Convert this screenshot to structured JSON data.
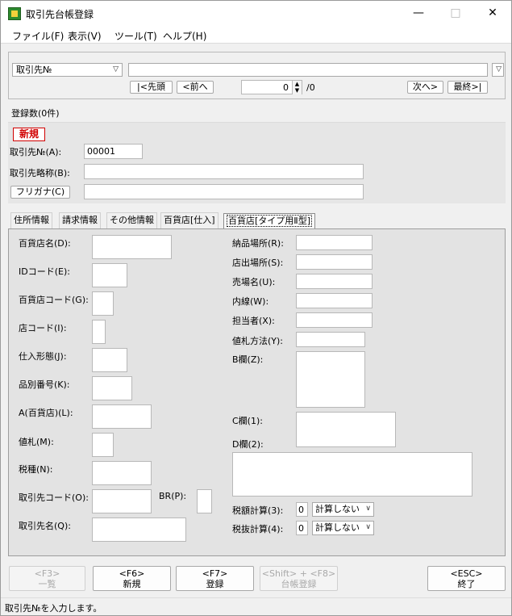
{
  "window": {
    "title": "取引先台帳登録",
    "minimize": "—",
    "maximize": "□",
    "close": "✕"
  },
  "menu": {
    "items": [
      "ファイル(F)",
      "表示(V)",
      "ツール(T)",
      "ヘルプ(H)"
    ]
  },
  "nav": {
    "key_select": "取引先№",
    "key_value": "",
    "first": "|<先頭",
    "prev": "<前へ",
    "position": "0",
    "total": "/0",
    "next": "次へ>",
    "last": "最終>|"
  },
  "count_label": "登録数(0件)",
  "new_badge": "新規",
  "header_fields": {
    "no_label": "取引先№(A):",
    "no_value": "00001",
    "short_name_label": "取引先略称(B):",
    "short_name_value": "",
    "furigana_button": "フリガナ(C)",
    "furigana_value": ""
  },
  "tabs": [
    "住所情報",
    "請求情報",
    "その他情報",
    "百貨店[仕入]",
    "百貨店[タイプ用Ⅱ型]"
  ],
  "left_fields": [
    {
      "label": "百貨店名(D):",
      "value": ""
    },
    {
      "label": "IDコード(E):",
      "value": ""
    },
    {
      "label": "百貨店コード(G):",
      "value": ""
    },
    {
      "label": "店コード(I):",
      "value": ""
    },
    {
      "label": "仕入形態(J):",
      "value": ""
    },
    {
      "label": "品別番号(K):",
      "value": ""
    },
    {
      "label": "A(百貨店)(L):",
      "value": ""
    },
    {
      "label": "値札(M):",
      "value": ""
    },
    {
      "label": "税種(N):",
      "value": ""
    },
    {
      "label": "取引先コード(O):",
      "value": ""
    },
    {
      "label": "取引先名(Q):",
      "value": ""
    }
  ],
  "br_label": "BR(P):",
  "right_fields": [
    {
      "label": "納品場所(R):",
      "value": ""
    },
    {
      "label": "店出場所(S):",
      "value": ""
    },
    {
      "label": "売場名(U):",
      "value": ""
    },
    {
      "label": "内線(W):",
      "value": ""
    },
    {
      "label": "担当者(X):",
      "value": ""
    },
    {
      "label": "値札方法(Y):",
      "value": ""
    },
    {
      "label": "B欄(Z):",
      "value": ""
    },
    {
      "label": "C欄(1):",
      "value": ""
    },
    {
      "label": "D欄(2):",
      "value": ""
    }
  ],
  "tax_calc": {
    "label1": "税額計算(3):",
    "code1": "0",
    "option1": "計算しない",
    "label2": "税抜計算(4):",
    "code2": "0",
    "option2": "計算しない"
  },
  "bottom_buttons": [
    {
      "key": "<F3>",
      "label": "一覧",
      "enabled": false
    },
    {
      "key": "<F6>",
      "label": "新規",
      "enabled": true
    },
    {
      "key": "<F7>",
      "label": "登録",
      "enabled": true
    },
    {
      "key": "<Shift> + <F8>",
      "label": "台帳登録",
      "enabled": false
    },
    {
      "key": "<ESC>",
      "label": "終了",
      "enabled": true
    }
  ],
  "status_text": "取引先№を入力します。"
}
